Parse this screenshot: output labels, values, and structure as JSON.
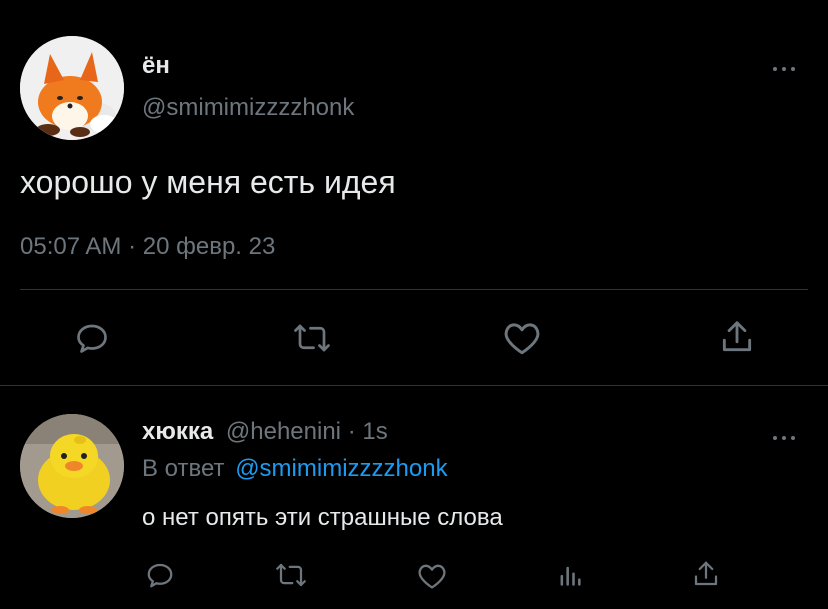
{
  "tweet": {
    "display_name": "ён",
    "handle": "@smimimizzzzhonk",
    "text": "хорошо у меня есть идея",
    "time": "05:07 AM",
    "separator": "·",
    "date": "20 февр. 23",
    "more_icon": "ellipsis-icon"
  },
  "tweet_actions": [
    "reply-icon",
    "retweet-icon",
    "like-icon",
    "share-icon"
  ],
  "reply": {
    "display_name": "хюкка",
    "handle": "@hehenini",
    "separator": "·",
    "age": "1s",
    "reply_prefix": "В ответ",
    "reply_to": "@smimimizzzzhonk",
    "text": "о нет опять эти страшные слова",
    "more_icon": "ellipsis-icon"
  },
  "reply_actions": [
    "reply-icon",
    "retweet-icon",
    "like-icon",
    "analytics-icon",
    "share-icon"
  ],
  "colors": {
    "background": "#000000",
    "text": "#e7e9ea",
    "muted": "#6e767d",
    "link": "#1d9bf0",
    "divider": "#2f3336"
  }
}
